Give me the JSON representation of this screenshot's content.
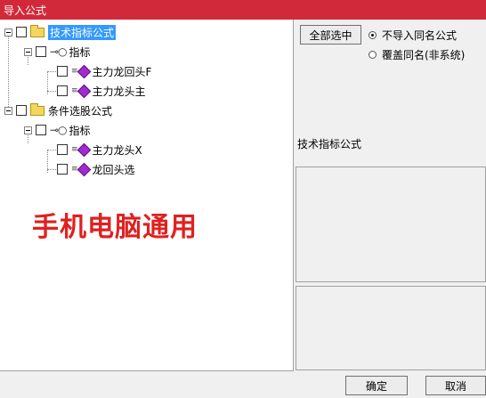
{
  "window": {
    "title": "导入公式"
  },
  "tree": {
    "nodes": [
      {
        "label": "技术指标公式"
      },
      {
        "label": "指标"
      },
      {
        "label": "主力龙回头F"
      },
      {
        "label": "主力龙头主"
      },
      {
        "label": "条件选股公式"
      },
      {
        "label": "指标"
      },
      {
        "label": "主力龙头X"
      },
      {
        "label": "龙回头选"
      }
    ]
  },
  "watermark": "手机电脑通用",
  "options": {
    "select_all_label": "全部选中",
    "radio_no_import_label": "不导入同名公式",
    "radio_overwrite_label": "覆盖同名(非系统)",
    "selected": "no_import"
  },
  "preview": {
    "label": "技术指标公式"
  },
  "footer": {
    "ok_label": "确定",
    "cancel_label": "取消"
  },
  "colors": {
    "titlebar": "#d2293a",
    "selection": "#3399ff",
    "watermark": "#e02020",
    "formula_icon": "#a32ad1"
  }
}
